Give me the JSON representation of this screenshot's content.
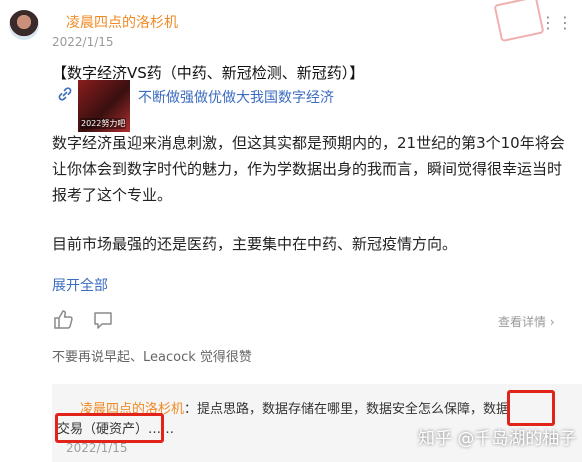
{
  "post": {
    "author": "凌晨四点的洛杉机",
    "date": "2022/1/15",
    "more_label": "⋮⋮",
    "title": "【数字经济VS药（中药、新冠检测、新冠药）】",
    "link_icon": "link-icon",
    "link_thumb_text": "2022努力吧",
    "link_text": "不断做强做优做大我国数字经济",
    "paragraph1": "数字经济虽迎来消息刺激，但这其实都是预期内的，21世纪的第3个10年将会让你体会到数字时代的魅力，作为学数据出身的我而言，瞬间觉得很幸运当时报考了这个专业。",
    "paragraph2": "目前市场最强的还是医药，主要集中在中药、新冠疫情方向。",
    "expand_label": "展开全部",
    "detail_label": "查看详情 ›",
    "likers_text": "不要再说早起、Leacock 觉得很赞"
  },
  "quote": {
    "author": "凌晨四点的洛杉机",
    "line1_rest": "：提点思路，数据存储在哪里，数据安全怎么保障，数据",
    "line2": "交易（硬资产）……",
    "date": "2022/1/15"
  },
  "watermark": "知乎 @千岛湖的柚子",
  "colors": {
    "author": "#f08a24",
    "link": "#3c6cc0",
    "highlight_box": "#e2231a"
  }
}
